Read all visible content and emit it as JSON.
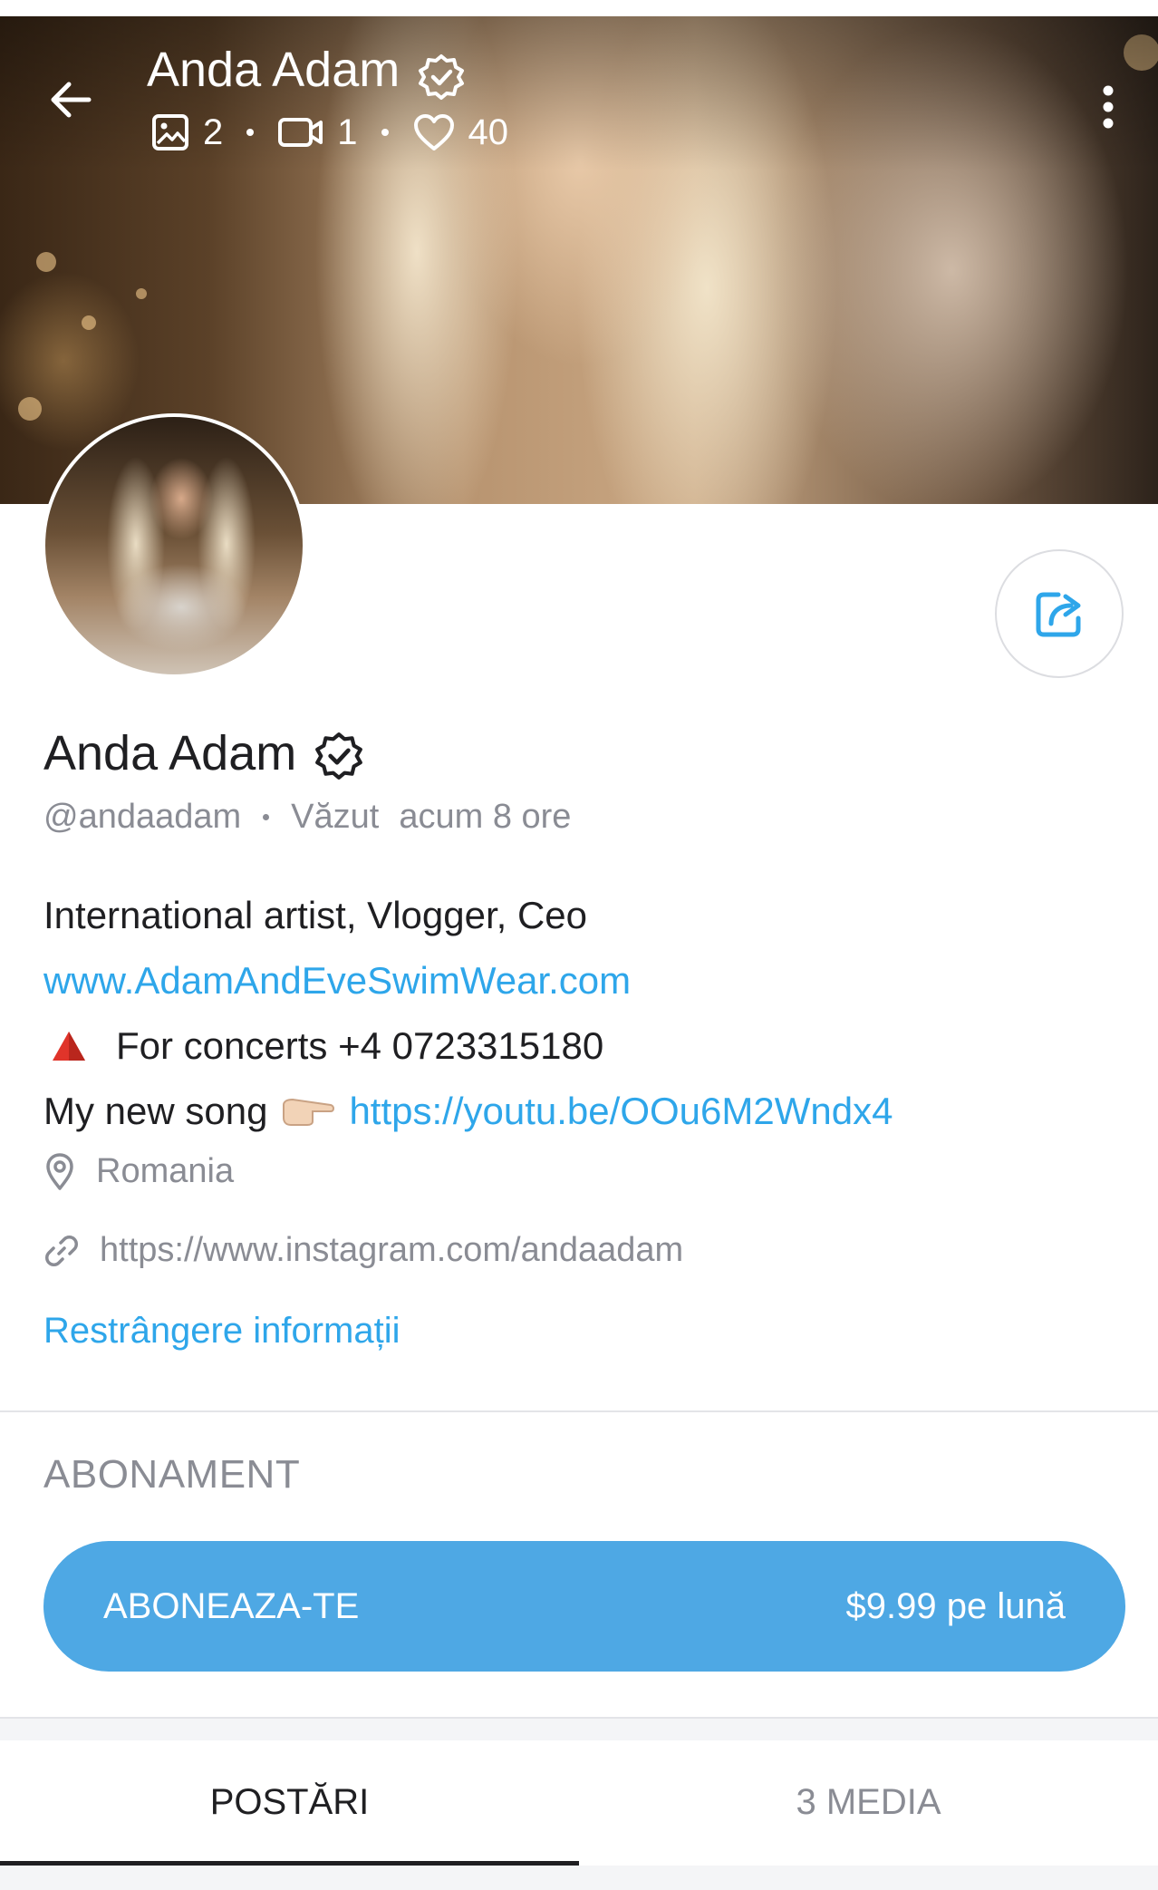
{
  "header": {
    "title": "Anda Adam",
    "stats": {
      "photos": "2",
      "videos": "1",
      "likes": "40"
    }
  },
  "profile": {
    "name": "Anda Adam",
    "handle": "@andaadam",
    "seen_label": "Văzut",
    "seen_time": "acum 8 ore",
    "bio": {
      "line1": "International artist, Vlogger, Ceo",
      "website": "www.AdamAndEveSwimWear.com",
      "concerts": "For concerts +4 0723315180",
      "song_prefix": "My new song",
      "song_link": "https://youtu.be/OOu6M2Wndx4"
    },
    "location": "Romania",
    "external_link": "https://www.instagram.com/andaadam",
    "collapse_label": "Restrângere informații"
  },
  "subscription": {
    "section_title": "ABONAMENT",
    "button_label": "ABONEAZA-TE",
    "price": "$9.99 pe lună"
  },
  "tabs": [
    {
      "label": "POSTĂRI",
      "active": true
    },
    {
      "label": "3 MEDIA",
      "active": false
    }
  ],
  "icons": {
    "back": "arrow-left-icon",
    "verified": "verified-badge-icon",
    "photo": "image-icon",
    "video": "video-camera-icon",
    "like": "heart-icon",
    "more": "more-vertical-icon",
    "share": "share-icon",
    "location": "location-pin-icon",
    "link": "link-icon",
    "warning": "red-triangle-emoji",
    "pointing": "pointing-right-emoji"
  },
  "colors": {
    "accent": "#2ea6ea",
    "button": "#4ea8e4",
    "muted": "#8a8c94",
    "text": "#1f1f22"
  }
}
